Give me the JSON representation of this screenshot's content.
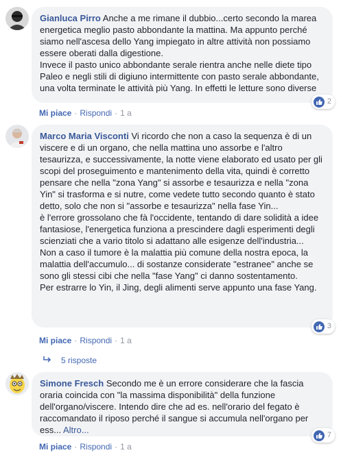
{
  "comments": [
    {
      "author": "Gianluca Pirro",
      "text": "Anche a me rimane il dubbio...certo secondo la marea energetica meglio pasto abbondante la mattina. Ma appunto perché siamo nell'ascesa dello Yang impiegato in altre attività non possiamo essere oberati dalla digestione.\nInvece il pasto unico abbondante serale rientra anche nelle diete tipo Paleo e negli stili di digiuno intermittente con pasto serale abbondante, una volta terminate le attività più Yang. In effetti le letture sono diverse",
      "reactions": "2",
      "like": "Mi piace",
      "reply": "Rispondi",
      "time": "1 a"
    },
    {
      "author": "Marco Maria Visconti",
      "text": "Vi ricordo che non a caso la sequenza è di un viscere e di un organo, che nella mattina uno assorbe e l'altro tesaurizza, e successivamente, la notte viene elaborato ed usato per gli scopi del proseguimento e mantenimento della vita, quindi è corretto pensare che nella \"zona Yang\" si assorbe e tesaurizza e nella \"zona Yin\" si trasforma e si nutre, come vedete tutto secondo quanto è stato detto, solo che non si \"assorbe e tesaurizza\" nella fase Yin...\nè l'errore grossolano che fà l'occidente, tentando di dare solidità a idee fantasiose, l'energetica funziona a prescindere dagli esperimenti degli scienziati che a vario titolo si adattano alle esigenze dell'industria...\nNon a caso il tumore è la malattia più comune della nostra epoca, la malattia dell'accumulo... di sostanze considerate \"estranee\" anche se sono gli stessi cibi che nella \"fase Yang\" ci danno sostentamento.\nPer estrarre lo Yin, il Jing, degli alimenti serve appunto una fase Yang.",
      "reactions": "3",
      "like": "Mi piace",
      "reply": "Rispondi",
      "time": "1 a",
      "replies_label": "5 risposte"
    },
    {
      "author": "Simone Fresch",
      "text": "Secondo me è un errore considerare che la fascia oraria coincida con \"la massima disponibilità\" della funzione dell'organo/viscere. Intendo dire che ad es. nell'orario del fegato è raccomandato il riposo perché il sangue si accumula nell'organo per ess...",
      "more": "Altro...",
      "reactions": "7",
      "like": "Mi piace",
      "reply": "Rispondi",
      "time": "1 a"
    }
  ]
}
